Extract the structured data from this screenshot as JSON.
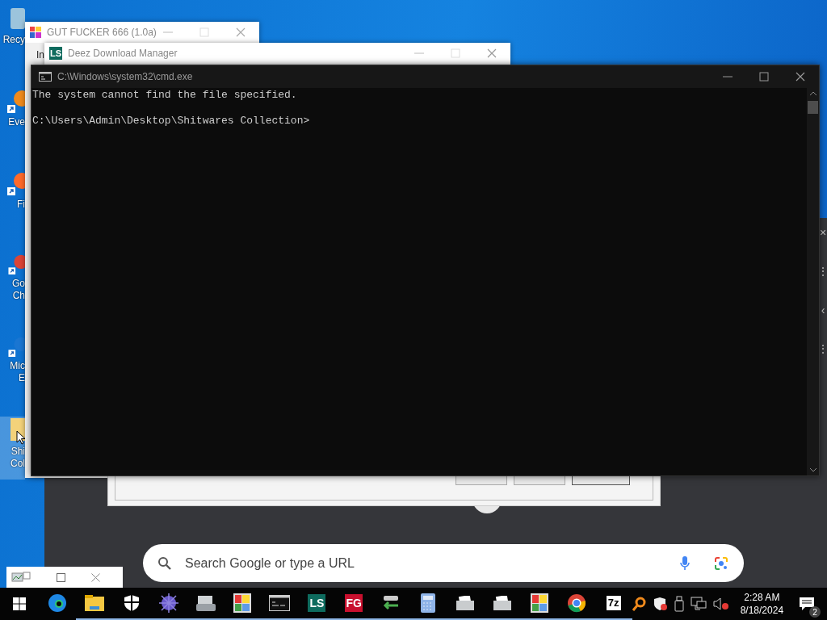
{
  "desktop_icons": [
    {
      "kind": "bin",
      "lines": [
        "Recy"
      ],
      "selected": false
    },
    {
      "kind": "orange",
      "lines": [
        "Eve"
      ],
      "selected": false
    },
    {
      "kind": "fox",
      "lines": [
        "Fi"
      ],
      "selected": false
    },
    {
      "kind": "chrome",
      "lines": [
        "Go",
        "Ch"
      ],
      "selected": false
    },
    {
      "kind": "edge",
      "lines": [
        "Mic",
        "E"
      ],
      "selected": false
    },
    {
      "kind": "folder",
      "lines": [
        "Shi",
        "Col"
      ],
      "selected": true
    }
  ],
  "browser": {
    "search": {
      "placeholder": "Search Google or type a URL"
    },
    "side_glyphs": [
      "×",
      "⋮",
      "‹",
      "⋮"
    ]
  },
  "scan_dialog": {
    "buttons": [
      {
        "kind": "normal"
      },
      {
        "kind": "normal"
      },
      {
        "kind": "default"
      }
    ]
  },
  "gut_window": {
    "title": "GUT FUCKER 666 (1.0a)",
    "body_text": "In"
  },
  "download_window": {
    "icon_label": "LS",
    "title": "Deez Download Manager"
  },
  "cmd_window": {
    "title": "C:\\Windows\\system32\\cmd.exe",
    "output": "The system cannot find the file specified.",
    "prompt": "C:\\Users\\Admin\\Desktop\\Shitwares Collection>"
  },
  "taskbar": {
    "apps": [
      {
        "kind": "edge",
        "running": false
      },
      {
        "kind": "folder",
        "running": true
      },
      {
        "kind": "shield",
        "running": true
      },
      {
        "kind": "ball",
        "running": true
      },
      {
        "kind": "scanner",
        "running": true
      },
      {
        "kind": "palette",
        "running": true
      },
      {
        "kind": "terminal",
        "running": true
      },
      {
        "kind": "tile",
        "label": "LS",
        "color": "#0e6b5e",
        "running": true
      },
      {
        "kind": "tile",
        "label": "FG",
        "color": "#c8102e",
        "running": true
      },
      {
        "kind": "usb",
        "running": true
      },
      {
        "kind": "calculator",
        "running": true
      },
      {
        "kind": "sheet",
        "running": true
      },
      {
        "kind": "sheet",
        "running": true
      },
      {
        "kind": "palette",
        "running": true
      },
      {
        "kind": "chrome",
        "running": true
      },
      {
        "kind": "sevenzip",
        "label": "7z",
        "running": true
      }
    ],
    "time": "2:28 AM",
    "date": "8/18/2024",
    "notification_count": "2"
  }
}
